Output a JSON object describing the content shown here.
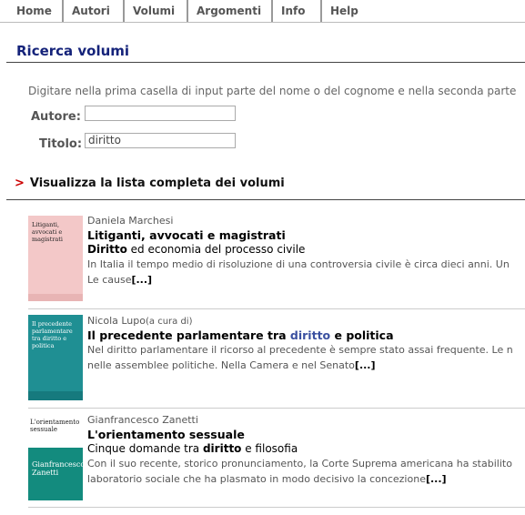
{
  "nav": {
    "items": [
      "Home",
      "Autori",
      "Volumi",
      "Argomenti",
      "Info",
      "Help"
    ]
  },
  "page": {
    "title": "Ricerca volumi"
  },
  "search": {
    "instructions": "Digitare nella prima casella di input parte del nome o del cognome e nella seconda parte",
    "author_label": "Autore:",
    "author_value": "",
    "title_label": "Titolo:",
    "title_value": "diritto"
  },
  "show_all": {
    "arrow": ">",
    "label": "Visualizza la lista completa dei volumi"
  },
  "more_label": "[...]",
  "books": [
    {
      "author": "Daniela Marchesi",
      "author_note": "",
      "title": "Litiganti, avvocati e magistrati",
      "subtitle_bold": "Diritto",
      "subtitle_rest": " ed economia del processo civile",
      "desc1": "In Italia il tempo medio di risoluzione di una controversia civile è circa dieci anni. Un",
      "desc2": "Le cause",
      "cover_text": "Litiganti, avvocati e magistrati",
      "cover_author": "Daniela Marchesi"
    },
    {
      "author": "Nicola Lupo",
      "author_note": "(a cura di)",
      "title_a": "Il precedente parlamentare tra ",
      "title_hl": "diritto",
      "title_b": " e politica",
      "desc1": "Nel diritto parlamentare il ricorso al precedente è sempre stato assai frequente. Le n",
      "desc2": "nelle assemblee politiche. Nella Camera e nel Senato",
      "cover_text": "Il precedente parlamentare tra diritto e politica",
      "cover_author": "Nicola Lupo"
    },
    {
      "author": "Gianfrancesco Zanetti",
      "author_note": "",
      "title": "L'orientamento sessuale",
      "subtitle_a": "Cinque domande tra ",
      "subtitle_bold": "diritto",
      "subtitle_b": " e filosofia",
      "desc1": "Con il suo recente, storico pronunciamento, la Corte Suprema americana ha stabilito",
      "desc2": "laboratorio sociale che ha plasmato in modo decisivo la concezione",
      "cover_text": "L'orientamento sessuale",
      "cover_author": "Gianfrancesco Zanetti"
    }
  ],
  "colors": {
    "title": "#15237a",
    "arrow": "#cc0000",
    "cover1": "#f3c8c8",
    "cover2": "#1f8f93",
    "cover3": "#138b7e"
  }
}
